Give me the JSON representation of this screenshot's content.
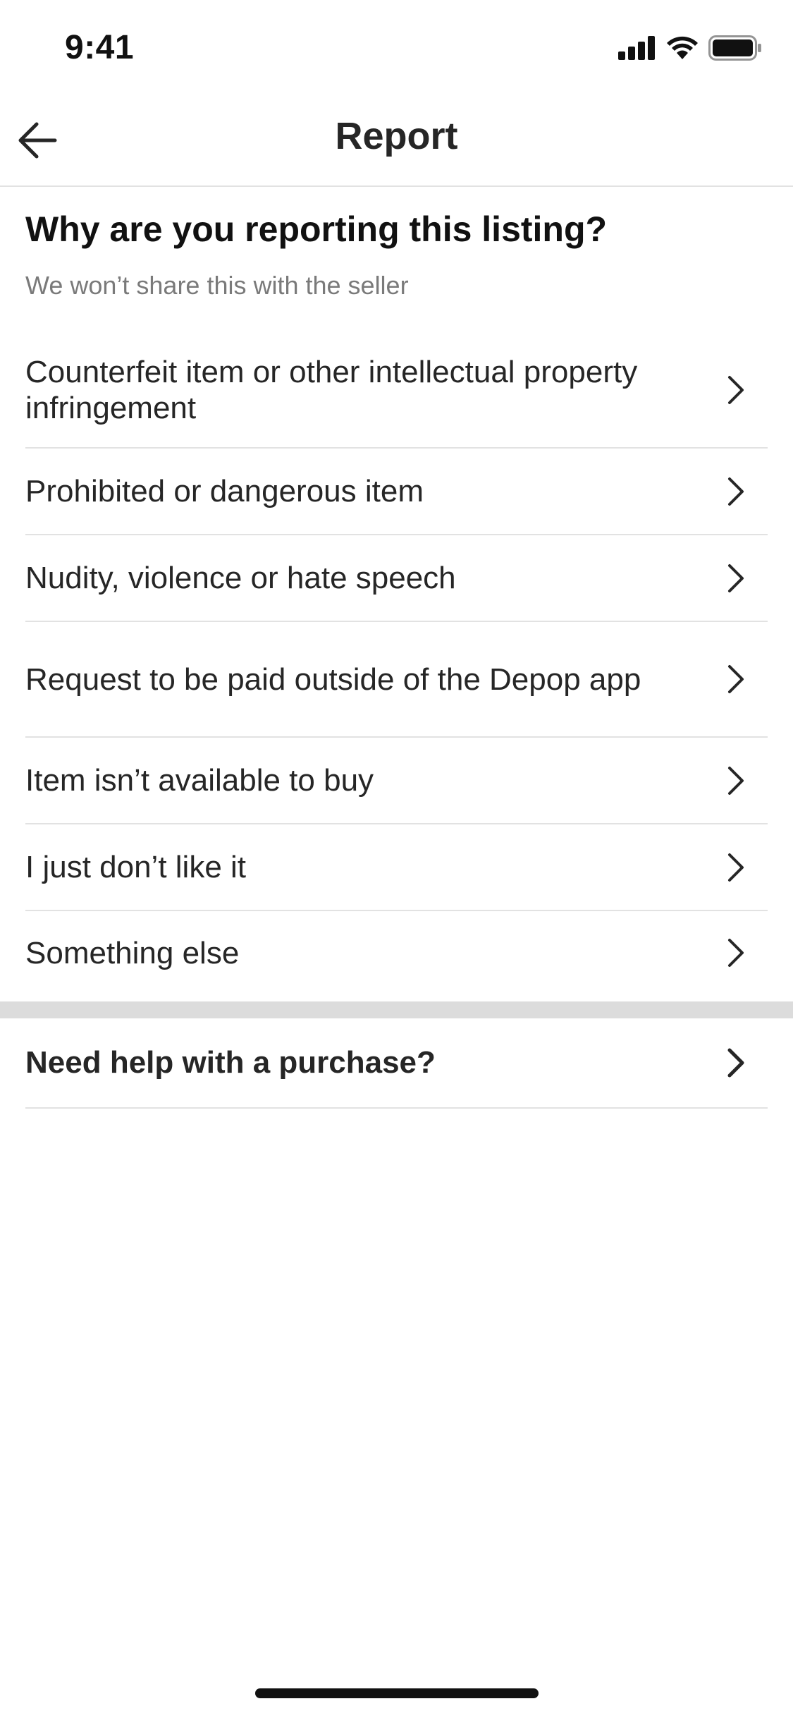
{
  "status_bar": {
    "time": "9:41",
    "icons": [
      "cellular-signal-icon",
      "wifi-icon",
      "battery-icon"
    ]
  },
  "header": {
    "title": "Report",
    "back_icon": "arrow-left-icon"
  },
  "content": {
    "question": "Why are you reporting this listing?",
    "subtext": "We won’t share this with the seller",
    "reasons": [
      {
        "label": "Counterfeit item or other intellectual property infringement"
      },
      {
        "label": "Prohibited or dangerous item"
      },
      {
        "label": "Nudity, violence or hate speech"
      },
      {
        "label": "Request to be paid outside of the Depop app"
      },
      {
        "label": "Item isn’t available to buy"
      },
      {
        "label": "I just don’t like it"
      },
      {
        "label": "Something else"
      }
    ],
    "help": {
      "label": "Need help with a purchase?"
    }
  },
  "colors": {
    "text": "#262626",
    "subtext": "#7a7a7a",
    "divider": "#e2e2e2",
    "section_divider": "#dcdcdc"
  }
}
